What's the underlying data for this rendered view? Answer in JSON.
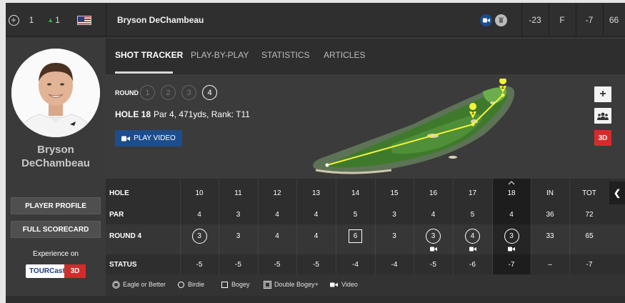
{
  "topbar": {
    "position": "1",
    "movement": "1",
    "player_name": "Bryson DeChambeau",
    "to_par": "-23",
    "thru": "F",
    "today": "-7",
    "total": "66",
    "flag_icon": "usa-flag-icon",
    "movement_icon": "arrow-up-icon"
  },
  "player": {
    "name_first": "Bryson",
    "name_last": "DeChambeau",
    "profile_button": "PLAYER PROFILE",
    "scorecard_button": "FULL SCORECARD",
    "experience_label": "Experience on",
    "tourcast_label": "TOURCast",
    "tourcast_3d": "3D"
  },
  "tabs": [
    "SHOT TRACKER",
    "PLAY-BY-PLAY",
    "STATISTICS",
    "ARTICLES"
  ],
  "tracker": {
    "round_label": "ROUND",
    "rounds": [
      "1",
      "2",
      "3",
      "4"
    ],
    "active_round": "4",
    "hole_label": "HOLE 18",
    "hole_info": "Par 4, 471yds, Rank: T11",
    "play_video": "PLAY VIDEO",
    "tool_3d": "3D"
  },
  "scorecard": {
    "headers": [
      "HOLE",
      "10",
      "11",
      "12",
      "13",
      "14",
      "15",
      "16",
      "17",
      "18",
      "IN",
      "TOT"
    ],
    "par": [
      "PAR",
      "4",
      "3",
      "4",
      "4",
      "5",
      "3",
      "4",
      "5",
      "4",
      "36",
      "72"
    ],
    "round": [
      "ROUND 4",
      "3",
      "3",
      "4",
      "4",
      "6",
      "3",
      "3",
      "4",
      "3",
      "33",
      "65"
    ],
    "status": [
      "STATUS",
      "-5",
      "-5",
      "-5",
      "-5",
      "-4",
      "-4",
      "-5",
      "-6",
      "-7",
      "–",
      "-7"
    ]
  },
  "legend": {
    "eagle": "Eagle or Better",
    "birdie": "Birdie",
    "bogey": "Bogey",
    "double": "Double Bogey+",
    "video": "Video"
  },
  "colors": {
    "accent_blue": "#1c4d8d",
    "accent_red": "#d62b2b",
    "movement_green": "#2fb34a",
    "shot_line": "#f3f33a"
  }
}
